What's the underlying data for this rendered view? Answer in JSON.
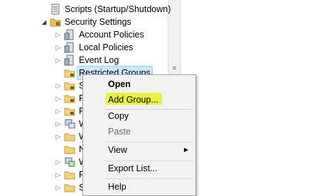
{
  "tree": {
    "items": [
      {
        "label": "Scripts (Startup/Shutdown)",
        "icon": "scripts-icon",
        "expander": ""
      },
      {
        "label": "Security Settings",
        "icon": "security-folder-icon",
        "expander": "open"
      },
      {
        "label": "Account Policies",
        "icon": "policy-icon",
        "expander": "closed"
      },
      {
        "label": "Local Policies",
        "icon": "policy-icon",
        "expander": "closed"
      },
      {
        "label": "Event Log",
        "icon": "policy-icon",
        "expander": "closed"
      },
      {
        "label": "Restricted Groups",
        "icon": "folder-lock-icon",
        "expander": ""
      },
      {
        "label": "S",
        "icon": "folder-lock-icon",
        "expander": "closed"
      },
      {
        "label": "R",
        "icon": "folder-lock-icon",
        "expander": "closed"
      },
      {
        "label": "F",
        "icon": "folder-lock-icon",
        "expander": "closed"
      },
      {
        "label": "W",
        "icon": "network-icon",
        "expander": "closed"
      },
      {
        "label": "W",
        "icon": "folder-icon",
        "expander": "closed"
      },
      {
        "label": "N",
        "icon": "folder-icon",
        "expander": ""
      },
      {
        "label": "W",
        "icon": "network-icon",
        "expander": "closed"
      },
      {
        "label": "P",
        "icon": "folder-icon",
        "expander": "closed"
      },
      {
        "label": "S",
        "icon": "folder-icon",
        "expander": "closed"
      }
    ]
  },
  "context_menu": {
    "open": "Open",
    "add_group": "Add Group...",
    "copy": "Copy",
    "paste": "Paste",
    "view": "View",
    "export_list": "Export List...",
    "help": "Help"
  },
  "colors": {
    "selection": "#cce8ff",
    "highlight_marker": "#f5ff1f",
    "menu_bg": "#f2f2f2"
  }
}
